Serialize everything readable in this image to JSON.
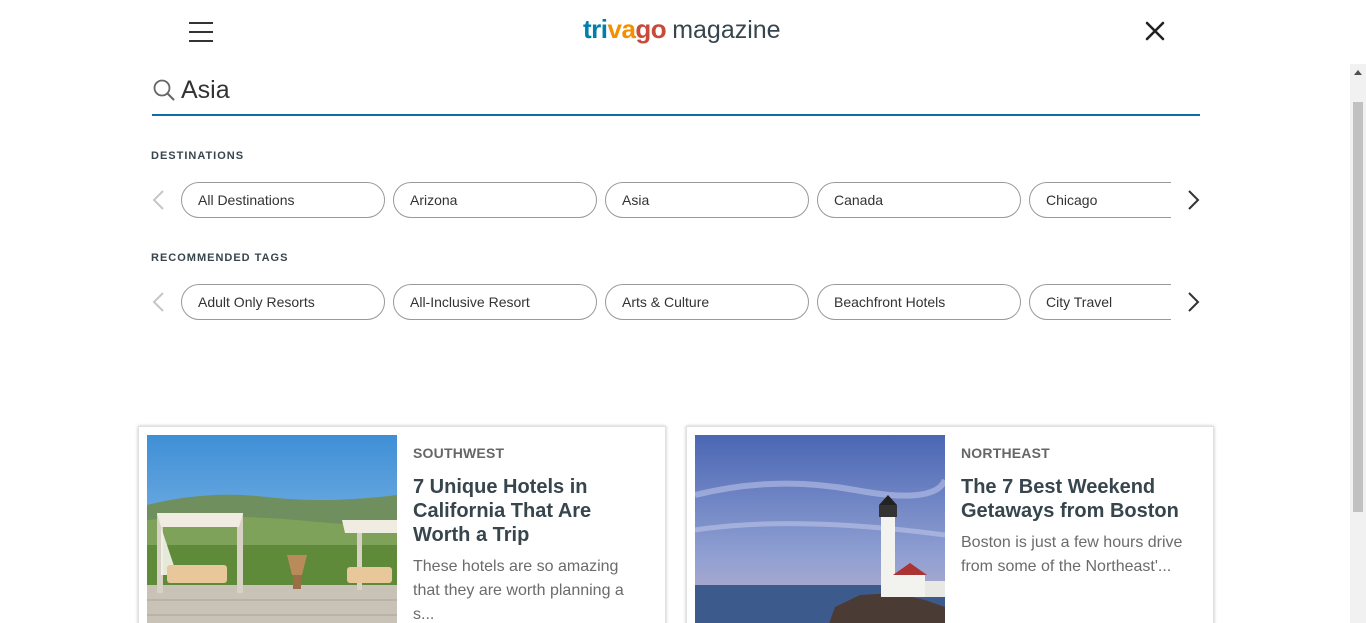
{
  "header": {
    "logo_brand_parts": [
      "tri",
      "va",
      "go"
    ],
    "logo_word": "magazine",
    "icons": {
      "menu": "hamburger-menu-icon",
      "close": "close-icon"
    }
  },
  "search": {
    "value": "Asia",
    "placeholder": "",
    "icon": "search-icon"
  },
  "destinations": {
    "label": "DESTINATIONS",
    "items": [
      "All Destinations",
      "Arizona",
      "Asia",
      "Canada",
      "Chicago"
    ]
  },
  "tags": {
    "label": "RECOMMENDED TAGS",
    "items": [
      "Adult Only Resorts",
      "All-Inclusive Resort",
      "Arts & Culture",
      "Beachfront Hotels",
      "City Travel"
    ]
  },
  "articles": [
    {
      "category": "SOUTHWEST",
      "title": "7 Unique Hotels in California That Are Worth a Trip",
      "description": "These hotels are so amazing that they are worth planning a s..."
    },
    {
      "category": "NORTHEAST",
      "title": "The 7 Best Weekend Getaways from Boston",
      "description": "Boston is just a few hours drive from some of the Northeast'..."
    }
  ],
  "colors": {
    "accent": "#0f6ea6",
    "logo_blue": "#007fad",
    "logo_orange": "#f48f00",
    "logo_red": "#c94a38"
  }
}
